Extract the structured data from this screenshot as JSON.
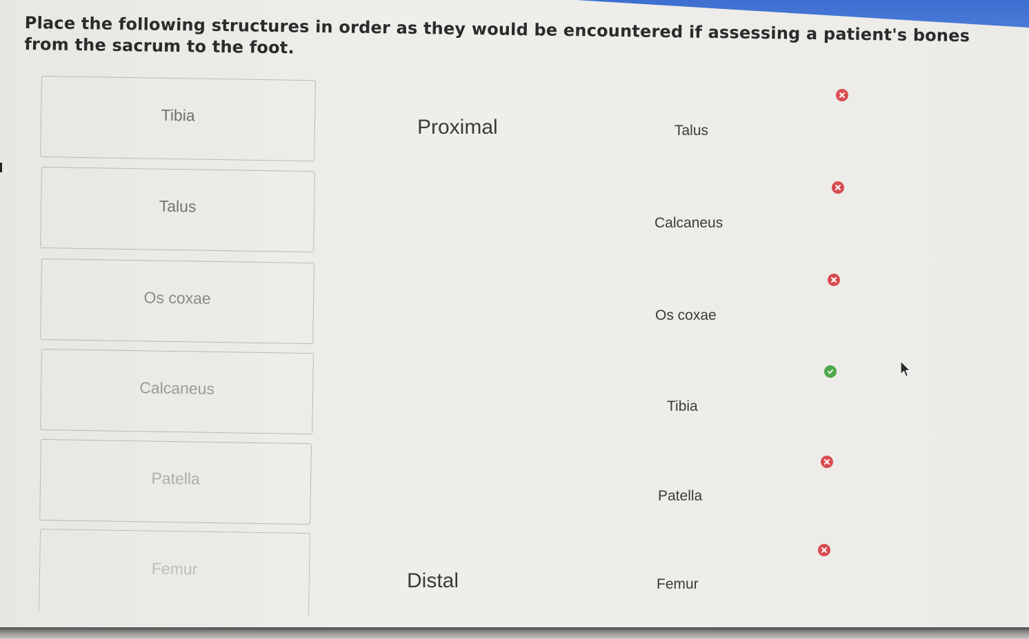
{
  "question": {
    "text": "Place the following structures in order as they would be encountered if assessing a patient's bones from the sacrum to the foot."
  },
  "choices": [
    {
      "label": "Tibia",
      "color": "#6f6f6f"
    },
    {
      "label": "Talus",
      "color": "#727272"
    },
    {
      "label": "Os coxae",
      "color": "#888888"
    },
    {
      "label": "Calcaneus",
      "color": "#9a9a9a"
    },
    {
      "label": "Patella",
      "color": "#adadad"
    },
    {
      "label": "Femur",
      "color": "#bdbdbd"
    }
  ],
  "axis": {
    "top_label": "Proximal",
    "bottom_label": "Distal"
  },
  "answers": [
    {
      "label": "Talus",
      "status": "incorrect"
    },
    {
      "label": "Calcaneus",
      "status": "incorrect"
    },
    {
      "label": "Os coxae",
      "status": "incorrect"
    },
    {
      "label": "Tibia",
      "status": "correct"
    },
    {
      "label": "Patella",
      "status": "incorrect"
    },
    {
      "label": "Femur",
      "status": "incorrect"
    }
  ],
  "colors": {
    "incorrect": "#d94c50",
    "correct": "#4fa84a",
    "header_blue": "#3d6fd0"
  }
}
